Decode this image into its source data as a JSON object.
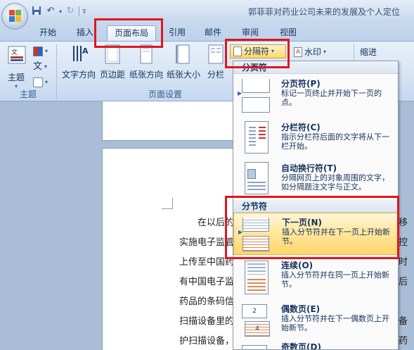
{
  "window": {
    "title": "郭菲菲对药业公司未来的发展及个人定位"
  },
  "quick_access": {
    "save_icon": "save-icon",
    "undo_icon": "undo-icon",
    "redo_icon": "redo-icon"
  },
  "tabs": [
    {
      "label": "开始"
    },
    {
      "label": "插入"
    },
    {
      "label": "页面布局",
      "active": true
    },
    {
      "label": "引用"
    },
    {
      "label": "邮件"
    },
    {
      "label": "审阅"
    },
    {
      "label": "视图"
    }
  ],
  "ribbon": {
    "theme_group": {
      "label": "主题",
      "theme_btn": "主题",
      "text_btn": "文"
    },
    "page_setup_group": {
      "label": "页面设置",
      "text_direction": "文字方向",
      "margins": "页边距",
      "orientation": "纸张方向",
      "size": "纸张大小",
      "columns": "分栏"
    },
    "breaks_btn": "分隔符",
    "watermark_btn": "水印",
    "indent_label": "缩进"
  },
  "dropdown": {
    "page_breaks_header": "分页符",
    "section_breaks_header": "分节符",
    "items": [
      {
        "title": "分页符(P)",
        "desc": "标记一页终止并开始下一页的点。"
      },
      {
        "title": "分栏符(C)",
        "desc": "指示分栏符后面的文字将从下一栏开始。"
      },
      {
        "title": "自动换行符(T)",
        "desc": "分隔网页上的对象周围的文字，如分隔题注文字与正文。"
      },
      {
        "title": "下一页(N)",
        "desc": "插入分节符并在下一页上开始新节。"
      },
      {
        "title": "连续(O)",
        "desc": "插入分节符并在同一页上开始新节。"
      },
      {
        "title": "偶数页(E)",
        "desc": "插入分节符并在下一偶数页上开始新节。"
      },
      {
        "title": "奇数页(D)",
        "desc": ""
      }
    ]
  },
  "document": {
    "lines": [
      "在以后的",
      "实施电子监管",
      "上传至中国药",
      "有中国电子监",
      "药品的条码信",
      "扫描设备里的",
      "护扫描设备，"
    ],
    "right_edge_chars": [
      "移",
      "控",
      "时",
      "后",
      "备",
      "药"
    ]
  },
  "colors": {
    "highlight": "#ffd56b",
    "annotation_red": "#e0161f",
    "ribbon_bg": "#d5e3f3"
  }
}
